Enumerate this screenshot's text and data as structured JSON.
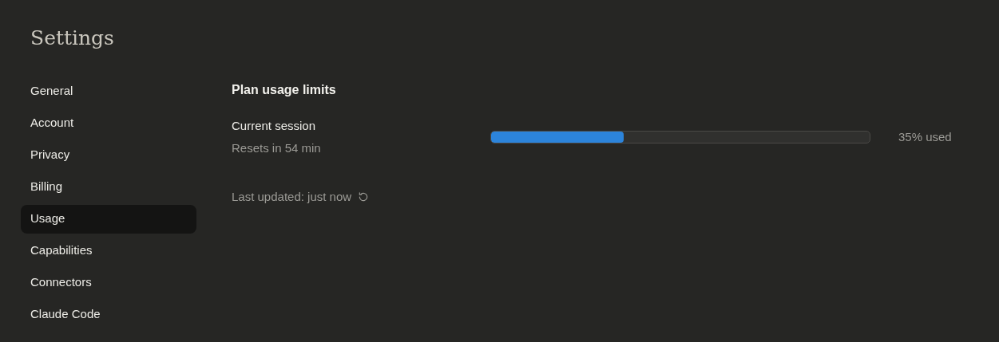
{
  "title": "Settings",
  "sidebar": {
    "items": [
      {
        "label": "General",
        "selected": false
      },
      {
        "label": "Account",
        "selected": false
      },
      {
        "label": "Privacy",
        "selected": false
      },
      {
        "label": "Billing",
        "selected": false
      },
      {
        "label": "Usage",
        "selected": true
      },
      {
        "label": "Capabilities",
        "selected": false
      },
      {
        "label": "Connectors",
        "selected": false
      },
      {
        "label": "Claude Code",
        "selected": false
      }
    ]
  },
  "section": {
    "heading": "Plan usage limits",
    "limits": [
      {
        "name": "Current session",
        "detail": "Resets in 54 min",
        "level": 0.35,
        "reading": "35% used"
      }
    ],
    "last_updated": "Last updated: just now"
  }
}
